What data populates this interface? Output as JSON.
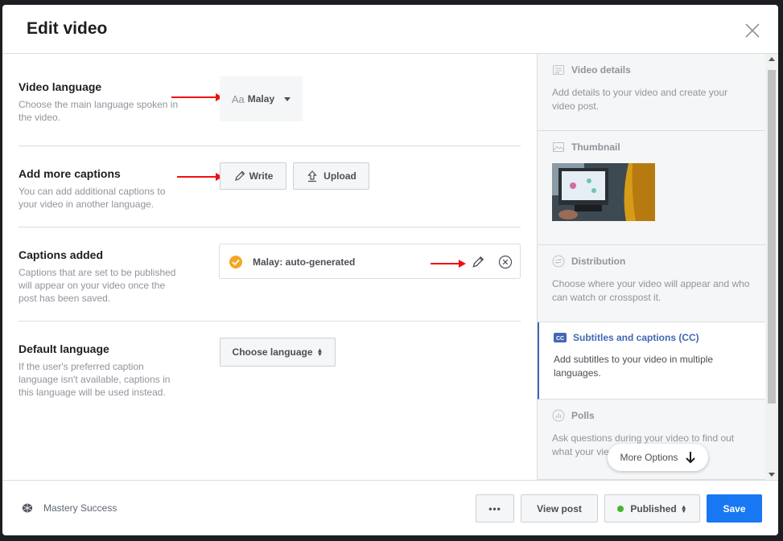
{
  "dialog": {
    "title": "Edit video"
  },
  "sections": {
    "video_language": {
      "title": "Video language",
      "desc": "Choose the main language spoken in the video.",
      "value": "Malay",
      "prefix": "Aa"
    },
    "add_captions": {
      "title": "Add more captions",
      "desc": "You can add additional captions to your video in another language.",
      "write_label": "Write",
      "upload_label": "Upload"
    },
    "captions_added": {
      "title": "Captions added",
      "desc": "Captions that are set to be published will appear on your video once the post has been saved.",
      "caption_item": "Malay: auto-generated"
    },
    "default_language": {
      "title": "Default language",
      "desc": "If the user's preferred caption language isn't available, captions in this language will be used instead.",
      "select_label": "Choose language"
    }
  },
  "sidebar": {
    "items": [
      {
        "title": "Video details",
        "desc": "Add details to your video and create your video post.",
        "icon": "details-icon"
      },
      {
        "title": "Thumbnail",
        "desc": "",
        "icon": "image-icon"
      },
      {
        "title": "Distribution",
        "desc": "Choose where your video will appear and who can watch or crosspost it.",
        "icon": "distribution-icon"
      },
      {
        "title": "Subtitles and captions (CC)",
        "desc": "Add subtitles to your video in multiple languages.",
        "icon": "cc-icon"
      },
      {
        "title": "Polls",
        "desc": "Ask questions during your video to find out what your vie",
        "icon": "poll-icon"
      }
    ],
    "more_options": "More Options"
  },
  "footer": {
    "page_name": "Mastery Success",
    "more_label": "•••",
    "view_post": "View post",
    "published": "Published",
    "save": "Save"
  },
  "colors": {
    "accent": "#4267b2",
    "save": "#1877f2",
    "check": "#f5a623",
    "status_green": "#42b72a",
    "arrow": "#ee1111"
  }
}
